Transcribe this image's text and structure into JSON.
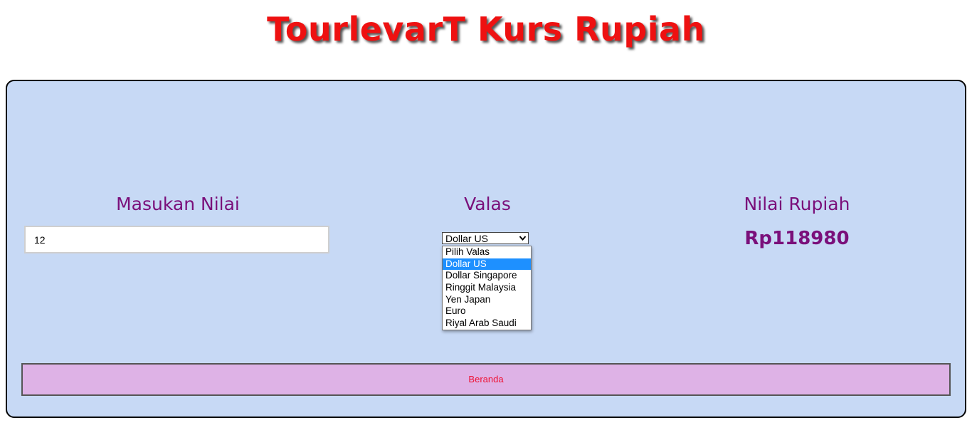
{
  "header": {
    "title": "TourlevarT Kurs Rupiah"
  },
  "form": {
    "amount_label": "Masukan Nilai",
    "amount_value": "12",
    "currency_label": "Valas",
    "currency_selected": "Dollar US",
    "currency_options": [
      "Pilih Valas",
      "Dollar US",
      "Dollar Singapore",
      "Ringgit Malaysia",
      "Yen Japan",
      "Euro",
      "Riyal Arab Saudi"
    ],
    "result_label": "Nilai Rupiah",
    "result_value": "Rp118980"
  },
  "nav": {
    "home_label": "Beranda"
  },
  "colors": {
    "title": "#ee1111",
    "panel_bg": "#c7d9f5",
    "label": "#7a0f7a",
    "button_bg": "#deb2e6",
    "button_text": "#ee1133",
    "option_highlight": "#1e90ff"
  },
  "icons": {
    "select_arrow": "chevron-down-icon"
  }
}
